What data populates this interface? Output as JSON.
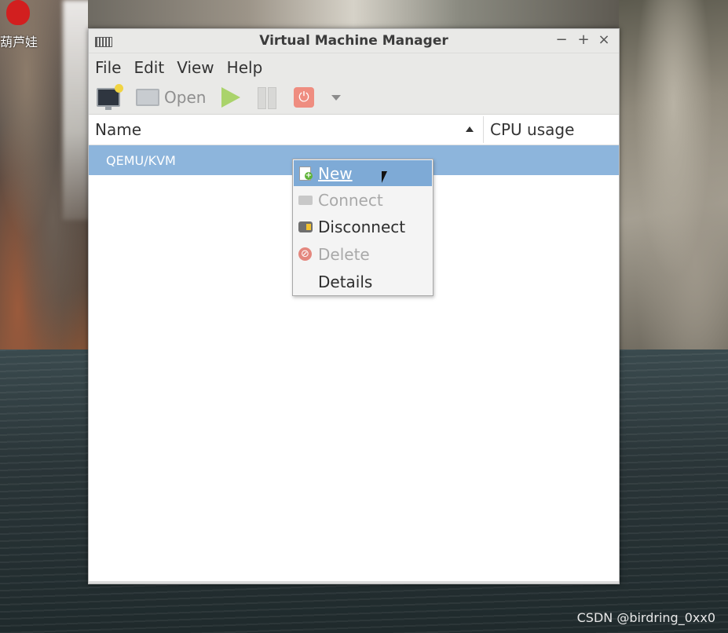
{
  "desktop": {
    "icon_label": "葫芦娃",
    "watermark": "CSDN @birdring_0xx0"
  },
  "window": {
    "title": "Virtual Machine Manager",
    "controls": {
      "minimize": "−",
      "maximize": "+",
      "close": "×"
    }
  },
  "menubar": {
    "items": [
      "File",
      "Edit",
      "View",
      "Help"
    ]
  },
  "toolbar": {
    "new_icon": "new-vm-icon",
    "open_label": "Open",
    "run_icon": "play-icon",
    "pause_icon": "pause-icon",
    "shutdown_icon": "power-icon",
    "dropdown_icon": "chevron-down-icon"
  },
  "table": {
    "columns": [
      "Name",
      "CPU usage"
    ],
    "sort_column": "Name",
    "rows": [
      {
        "name": "QEMU/KVM",
        "cpu": ""
      }
    ]
  },
  "context_menu": {
    "items": [
      {
        "label": "New",
        "state": "highlighted",
        "icon": "new-doc-icon"
      },
      {
        "label": "Connect",
        "state": "disabled",
        "icon": "plug-icon"
      },
      {
        "label": "Disconnect",
        "state": "enabled",
        "icon": "unplug-icon"
      },
      {
        "label": "Delete",
        "state": "disabled",
        "icon": "delete-icon"
      },
      {
        "label": "Details",
        "state": "enabled",
        "icon": ""
      }
    ]
  },
  "colors": {
    "selection": "#8db5dc",
    "menu_highlight": "#7eaad6",
    "chrome": "#e9e9e7",
    "disabled_text": "#a9a9a9"
  }
}
